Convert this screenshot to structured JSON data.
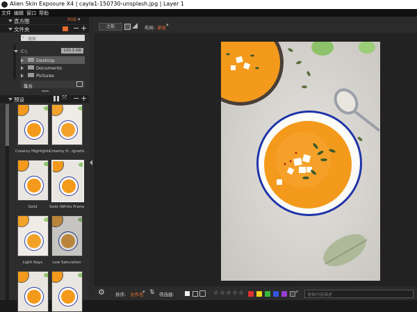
{
  "window": {
    "title": "Alien Skin Exposure X4 | cayla1-150730-unsplash.jpg | Layer 1"
  },
  "menu": [
    "文件",
    "编辑",
    "窗口",
    "帮助"
  ],
  "histogram": {
    "label": "直方图",
    "mode": "RGB"
  },
  "folders": {
    "label": "文件夹",
    "search_placeholder": "搜索",
    "drive": "C:\\",
    "drive_size": "120.3 GB",
    "items": [
      "Desktop",
      "Documents",
      "Pictures"
    ],
    "collection": "集合"
  },
  "presets": {
    "label": "预设",
    "items": [
      "Creamy Highlights",
      "Creamy H...ignette",
      "Gold",
      "Gold (White Frame)",
      "Light Rays",
      "Low Saturation"
    ]
  },
  "toolbar": {
    "before_label": "之前",
    "layout_label": "布局:",
    "layout_value": "单张"
  },
  "bottom": {
    "sort_label": "排序:",
    "sort_value": "文件名",
    "filter_label": "筛选器:",
    "search_placeholder": "搜索内容描述"
  },
  "colors": {
    "accent": "#e46b2c",
    "swatches": [
      "#e03030",
      "#f2d21a",
      "#38b838",
      "#3456e0",
      "#9a3bd2",
      "#444444"
    ]
  },
  "stars": [
    "☆",
    "☆",
    "☆",
    "☆",
    "☆"
  ]
}
